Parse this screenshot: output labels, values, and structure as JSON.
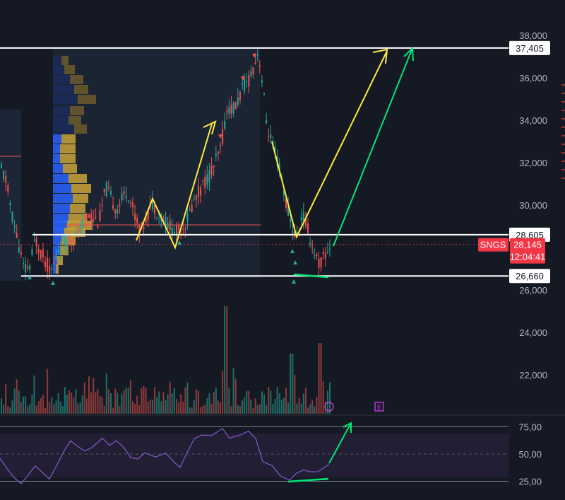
{
  "chart_data": {
    "type": "candlestick",
    "ticker": "SNGS",
    "current_price": "28,145",
    "countdown": "12:04:41",
    "price_axis": {
      "range": [
        25400,
        38600
      ],
      "ticks": [
        38000,
        36000,
        34000,
        32000,
        30000,
        26000,
        24000,
        22000
      ],
      "tick_labels": [
        "38,000",
        "36,000",
        "34,000",
        "32,000",
        "30,000",
        "26,000",
        "24,000",
        "22,000"
      ]
    },
    "levels": [
      {
        "value": 37405,
        "label": "37,405"
      },
      {
        "value": 28605,
        "label": "28,605"
      },
      {
        "value": 26660,
        "label": "26,660"
      }
    ],
    "rsi_axis": {
      "range": [
        20,
        80
      ],
      "ticks": [
        75,
        50,
        25
      ],
      "tick_labels": [
        "75,00",
        "50,00",
        "25,00"
      ]
    },
    "markers": [
      "dividend-icon",
      "earnings-icon"
    ],
    "earnings_label": "E",
    "colors": {
      "up": "#26a69a",
      "down": "#ef5350",
      "rsi": "#7e57c2",
      "annotation_yellow": "#ffeb3b",
      "annotation_green": "#00e676",
      "price_badge": "#f23645",
      "background": "#151924"
    }
  }
}
